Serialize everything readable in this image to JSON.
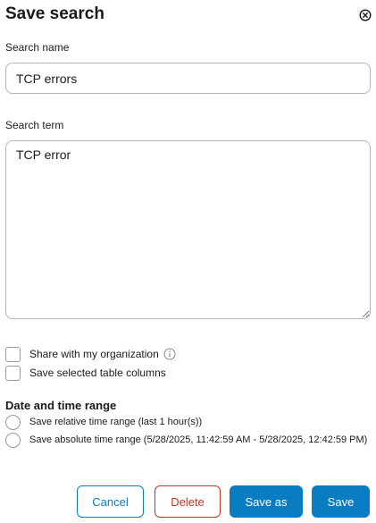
{
  "dialog": {
    "title": "Save search",
    "close_icon": "close-circle-icon"
  },
  "search_name": {
    "label": "Search name",
    "value": "TCP errors"
  },
  "search_term": {
    "label": "Search term",
    "value": "TCP error"
  },
  "options": {
    "share_label": "Share with my organization",
    "share_checked": false,
    "share_info_icon": "info-icon",
    "columns_label": "Save selected table columns",
    "columns_checked": false
  },
  "date_time": {
    "heading": "Date and time range",
    "relative_label": "Save relative time range (last 1 hour(s))",
    "relative_selected": false,
    "absolute_label": "Save absolute time range (5/28/2025, 11:42:59 AM - 5/28/2025, 12:42:59 PM)",
    "absolute_selected": false
  },
  "buttons": {
    "cancel": "Cancel",
    "delete": "Delete",
    "save_as": "Save as",
    "save": "Save"
  },
  "colors": {
    "primary": "#0a7cc1",
    "danger": "#c8341f",
    "border": "#b5b5b5"
  }
}
